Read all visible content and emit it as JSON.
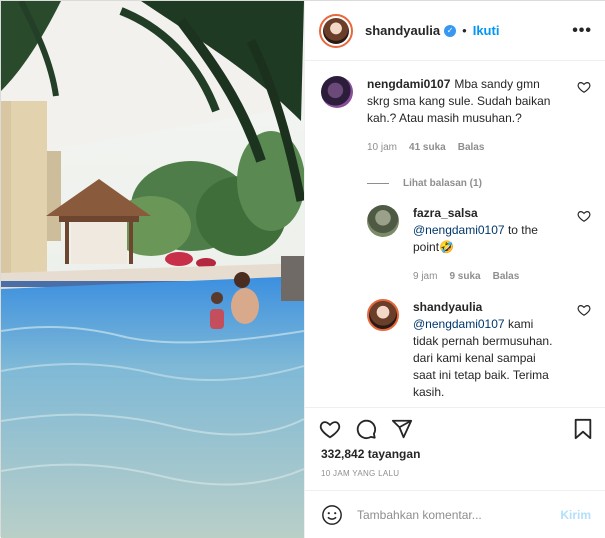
{
  "header": {
    "username": "shandyaulia",
    "verified_icon": "verified-badge-icon",
    "separator": "•",
    "follow_label": "Ikuti",
    "more_label": "•••"
  },
  "comments": [
    {
      "username": "nengdami0107",
      "text": "Mba sandy gmn skrg sma kang sule. Sudah baikan kah.? Atau masih musuhan.?",
      "time": "10 jam",
      "likes": "41 suka",
      "reply_label": "Balas"
    }
  ],
  "view_replies_label": "Lihat balasan (1)",
  "replies": [
    {
      "username": "fazra_salsa",
      "mention": "@nengdami0107",
      "text": "to the point🤣",
      "time": "9 jam",
      "likes": "9 suka",
      "reply_label": "Balas"
    },
    {
      "username": "shandyaulia",
      "mention": "@nengdami0107",
      "text": "kami tidak pernah bermusuhan. dari kami kenal sampai saat ini tetap baik. Terima kasih."
    }
  ],
  "views": "332,842 tayangan",
  "time_ago": "10 JAM YANG LALU",
  "add_comment": {
    "placeholder": "Tambahkan komentar...",
    "post_label": "Kirim"
  },
  "colors": {
    "accent": "#0095f6",
    "post_disabled": "#b2dffc",
    "muted": "#8e8e8e"
  }
}
